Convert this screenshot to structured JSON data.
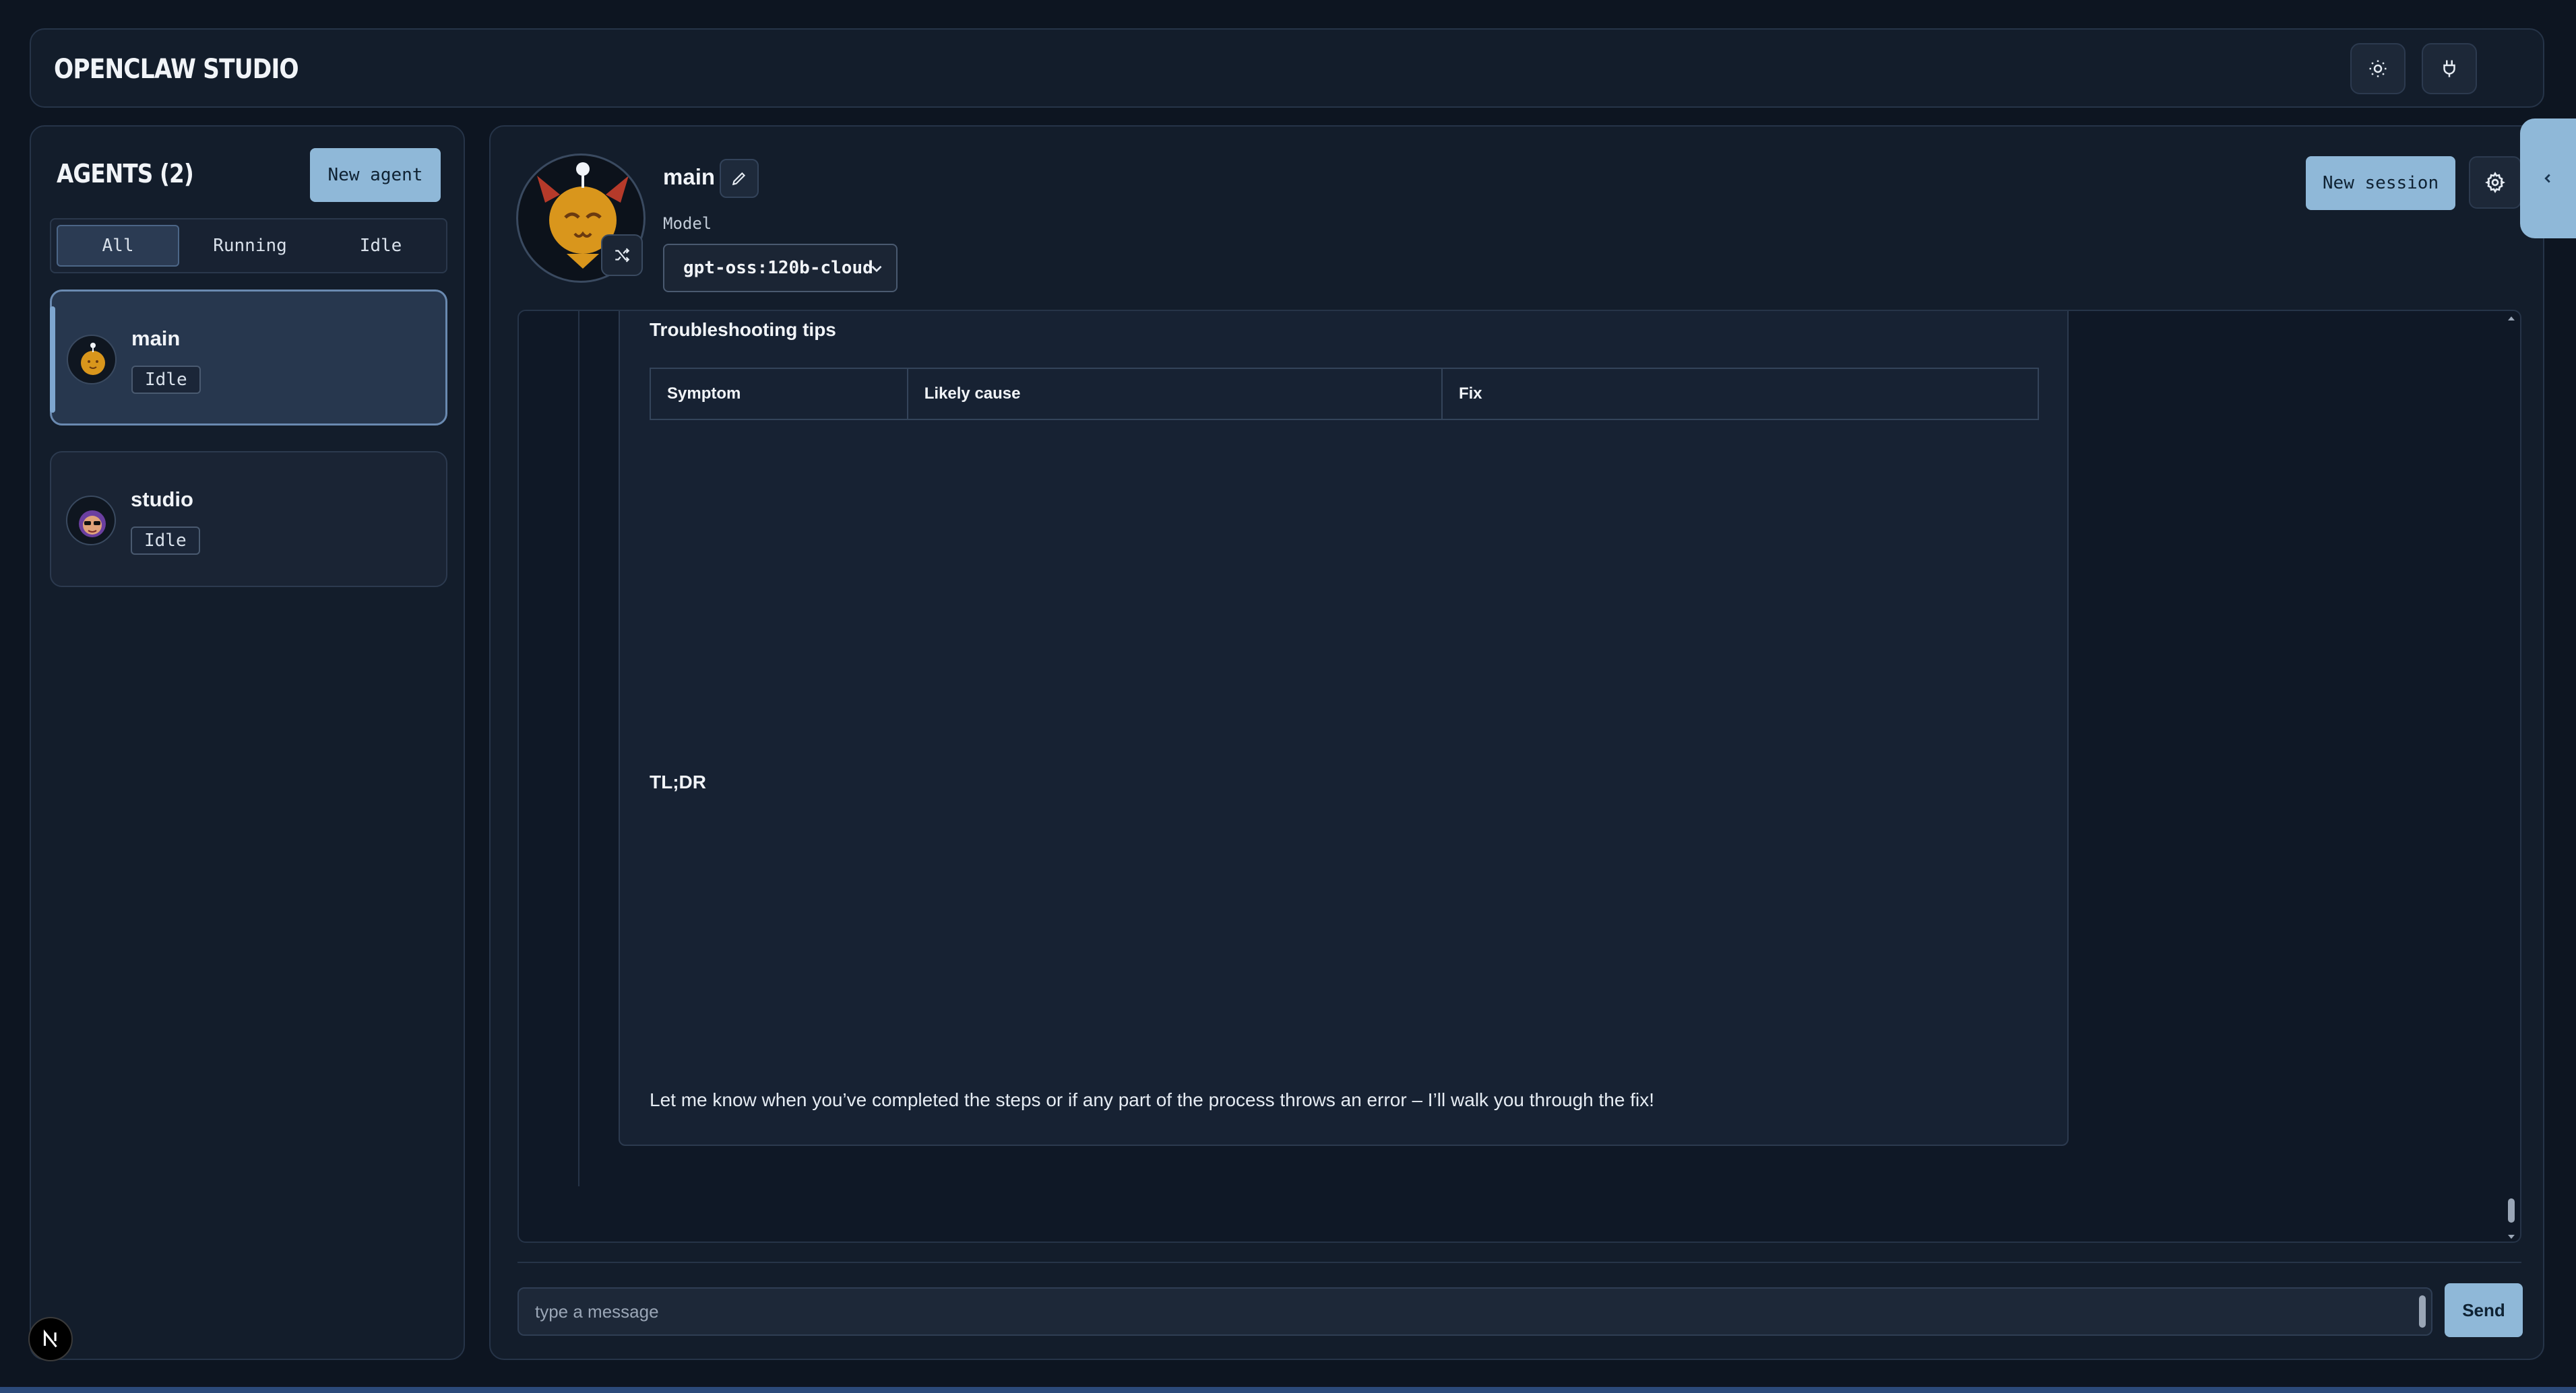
{
  "app": {
    "title": "OPENCLAW STUDIO"
  },
  "header": {
    "theme_icon": "sun-icon",
    "connect_icon": "plug-icon"
  },
  "sidebar": {
    "heading": "AGENTS (2)",
    "new_agent_label": "New agent",
    "filters": [
      "All",
      "Running",
      "Idle"
    ],
    "active_filter": "All",
    "agents": [
      {
        "name": "main",
        "status": "Idle",
        "selected": true
      },
      {
        "name": "studio",
        "status": "Idle",
        "selected": false
      }
    ]
  },
  "main": {
    "agent_name": "main",
    "model_label": "Model",
    "model_value": "gpt-oss:120b-cloud",
    "new_session_label": "New session"
  },
  "message": {
    "tips_heading": "Troubleshooting tips",
    "table": {
      "headers": [
        "Symptom",
        "Likely cause",
        "Fix"
      ]
    },
    "tldr_heading": "TL;DR",
    "paragraph_2": "Let me know when you’ve completed the steps or if any part of the process throws an error – I’ll walk you through the fix!"
  },
  "composer": {
    "placeholder": "type a message",
    "send_label": "Send"
  },
  "colors": {
    "accent": "#8fb8d8",
    "background": "#0d1521",
    "panel": "#131d2b"
  }
}
